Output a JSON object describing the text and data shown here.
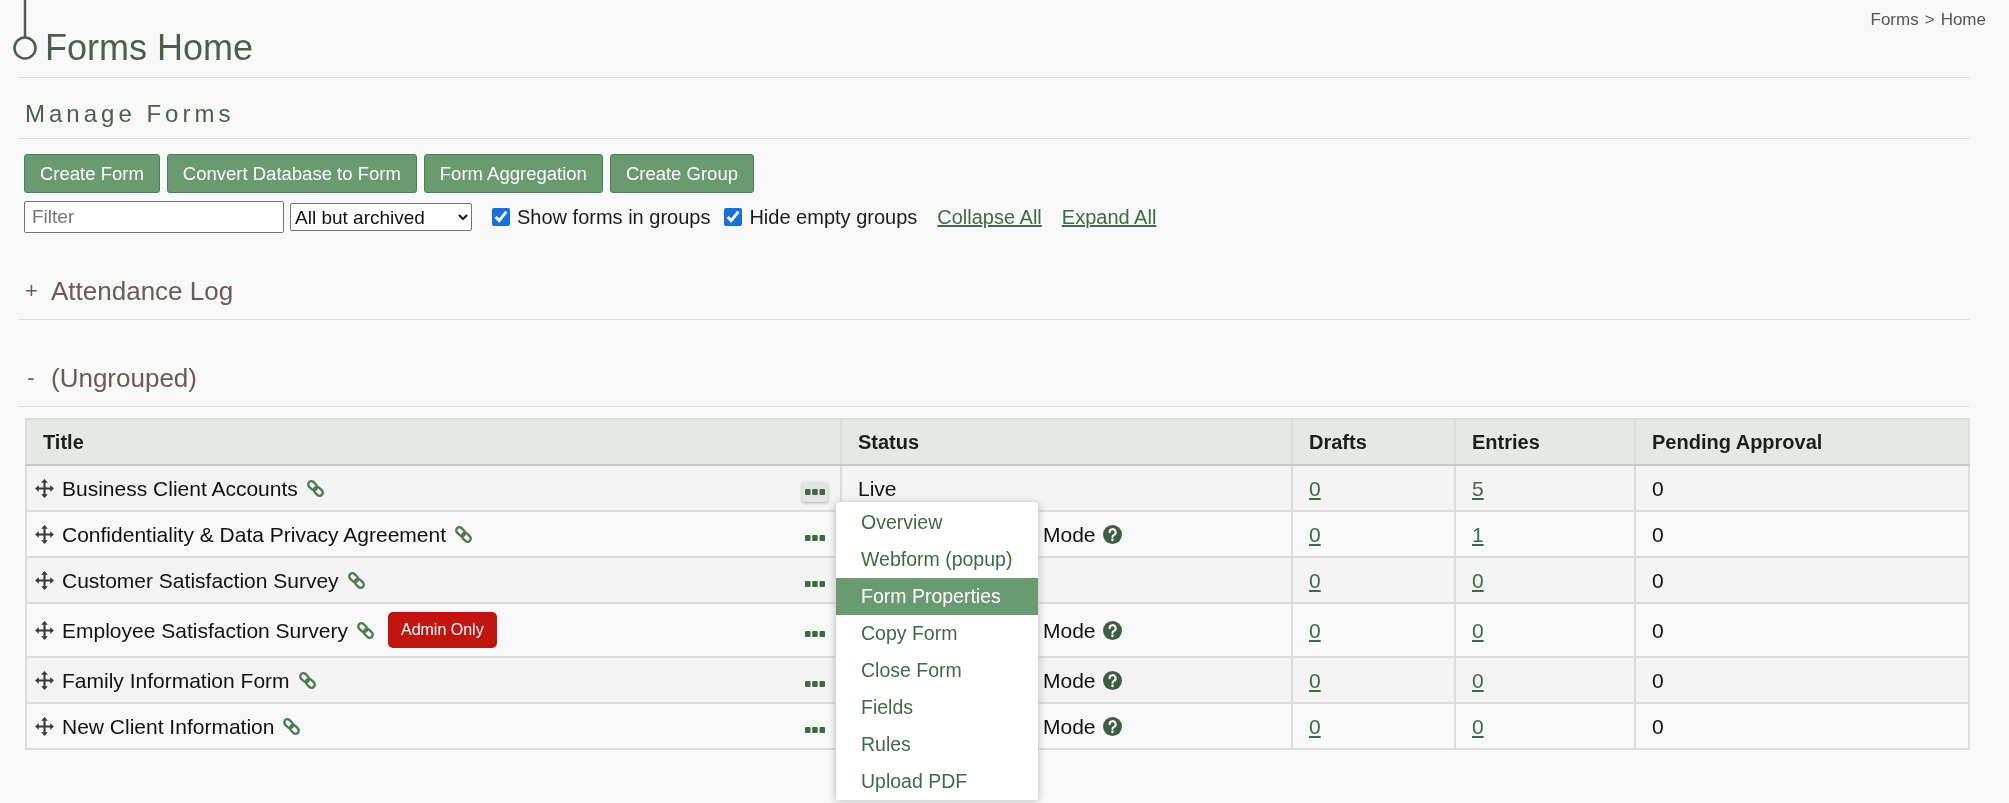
{
  "header": {
    "title": "Forms Home",
    "breadcrumb": {
      "items": [
        "Forms",
        "Home"
      ],
      "separator": ">"
    }
  },
  "section": {
    "title": "Manage Forms"
  },
  "buttons": [
    "Create Form",
    "Convert Database to Form",
    "Form Aggregation",
    "Create Group"
  ],
  "filters": {
    "filter": {
      "placeholder": "Filter"
    },
    "select": {
      "value": "All but archived"
    },
    "checkboxes": [
      {
        "label": "Show forms in groups",
        "checked": true
      },
      {
        "label": "Hide empty groups",
        "checked": true
      }
    ],
    "links": [
      "Collapse All",
      "Expand All"
    ]
  },
  "groups": [
    {
      "toggle": "+",
      "name": "Attendance Log"
    },
    {
      "toggle": "-",
      "name": "(Ungrouped)",
      "table": {
        "columns": [
          "Title",
          "Status",
          "Drafts",
          "Entries",
          "Pending Approval"
        ],
        "rows": [
          {
            "title": "Business Client Accounts",
            "actions_open": true,
            "status": {
              "text": "Live",
              "help": false
            },
            "drafts": "0",
            "entries": "5",
            "pending": "0"
          },
          {
            "title": "Confidentiality & Data Privacy Agreement",
            "actions_open": false,
            "status": {
              "text": "Mode",
              "help": true
            },
            "drafts": "0",
            "entries": "1",
            "pending": "0"
          },
          {
            "title": "Customer Satisfaction Survey",
            "actions_open": false,
            "drafts": "0",
            "entries": "0",
            "pending": "0"
          },
          {
            "title": "Employee Satisfaction Survery",
            "badge": "Admin Only",
            "actions_open": false,
            "status": {
              "text": "Mode",
              "help": true
            },
            "drafts": "0",
            "entries": "0",
            "pending": "0"
          },
          {
            "title": "Family Information Form",
            "actions_open": false,
            "status": {
              "text": "Mode",
              "help": true
            },
            "drafts": "0",
            "entries": "0",
            "pending": "0"
          },
          {
            "title": "New Client Information",
            "actions_open": false,
            "status": {
              "text": "Mode",
              "help": true
            },
            "drafts": "0",
            "entries": "0",
            "pending": "0"
          }
        ],
        "row_menu": [
          {
            "label": "Overview",
            "selected": false
          },
          {
            "label": "Webform (popup)",
            "selected": false
          },
          {
            "label": "Form Properties",
            "selected": true
          },
          {
            "label": "Copy Form",
            "selected": false
          },
          {
            "label": "Close Form",
            "selected": false
          },
          {
            "label": "Fields",
            "selected": false
          },
          {
            "label": "Rules",
            "selected": false
          },
          {
            "label": "Upload PDF",
            "selected": false
          }
        ]
      }
    }
  ]
}
